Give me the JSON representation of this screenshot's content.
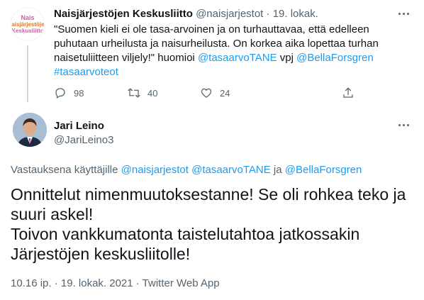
{
  "parent_tweet": {
    "avatar_lines": [
      "Naisjärjestöjen",
      "Keskusliitto"
    ],
    "avatar_top": "Nais",
    "display_name": "Naisjärjestöjen Keskusliitto",
    "handle": "@naisjarjestot",
    "separator": "·",
    "date": "19. lokak.",
    "text_part1": "\"Suomen kieli ei ole tasa-arvoinen ja on turhauttavaa, että edelleen puhutaan urheilusta ja naisurheilusta. On korkea aika lopettaa turhan naisetuliitteen viljely!\" huomioi ",
    "mention1": "@tasaarvoTANE",
    "text_part2": " vpj ",
    "mention2": "@BellaForsgren",
    "hashtag": "#tasaarvoteot",
    "reply_count": "98",
    "retweet_count": "40",
    "like_count": "24"
  },
  "main_tweet": {
    "display_name": "Jari Leino",
    "handle": "@JariLeino3",
    "replying_prefix": "Vastauksena käyttäjille ",
    "replying_mention1": "@naisjarjestot",
    "replying_mention2": "@tasaarvoTANE",
    "replying_and": " ja ",
    "replying_mention3": "@BellaForsgren",
    "body_line1": "Onnittelut nimenmuutoksestanne! Se oli rohkea teko ja suuri askel!",
    "body_line2": "Toivon vankkumatonta taistelutahtoa jatkossakin Järjestöjen keskusliitolle!",
    "meta": "10.16 ip. · 19. lokak. 2021 · Twitter Web App"
  },
  "colors": {
    "link": "#1d9bf0",
    "muted": "#536471",
    "text": "#0f1419"
  }
}
